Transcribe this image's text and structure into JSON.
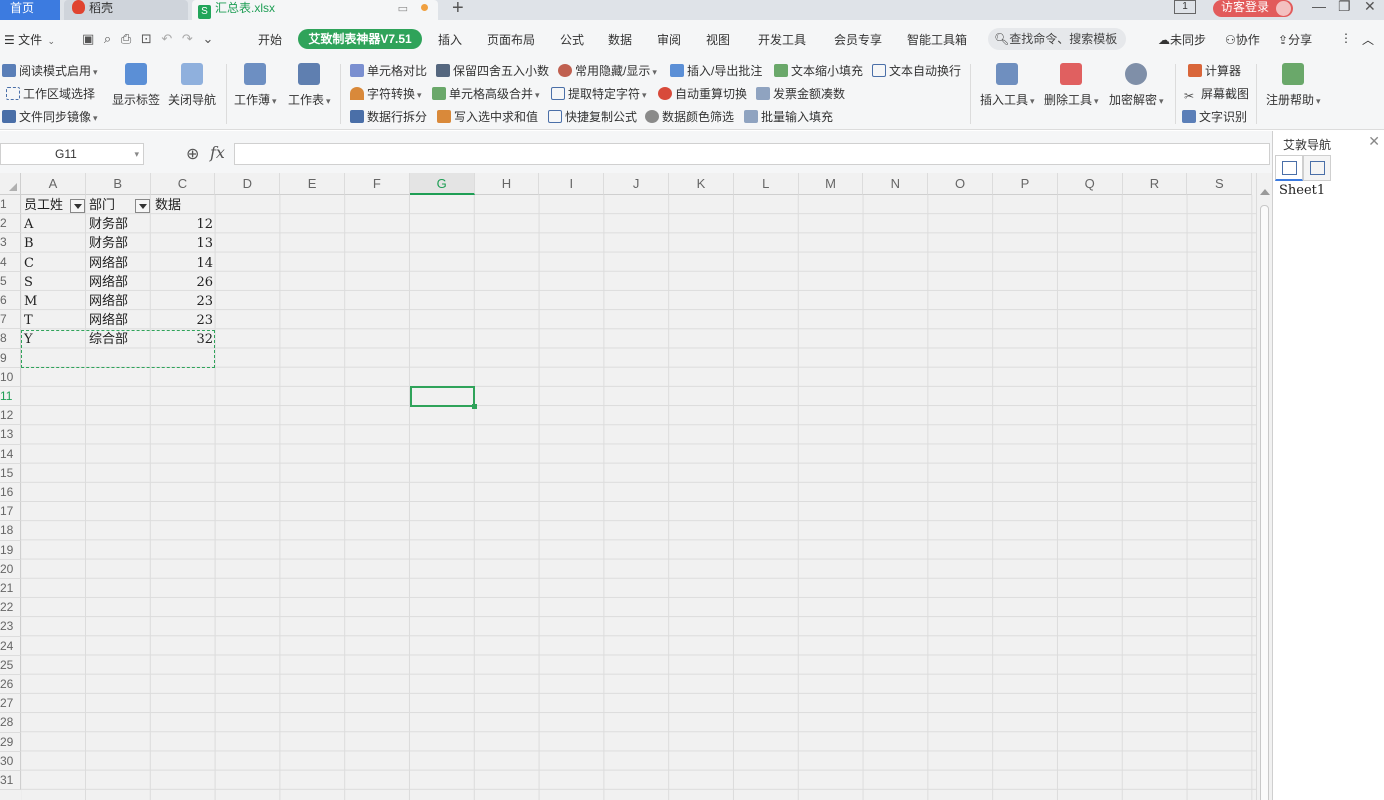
{
  "tabs": {
    "home": "首页",
    "daoke": "稻壳",
    "file": "汇总表.xlsx",
    "new_tab": "+"
  },
  "titlebar": {
    "badge": "1",
    "login": "访客登录",
    "minimize": "—",
    "restore": "❐",
    "close": "✕"
  },
  "menu": {
    "file": "文件",
    "items": [
      "开始",
      "艾致制表神器V7.51",
      "插入",
      "页面布局",
      "公式",
      "数据",
      "审阅",
      "视图",
      "开发工具",
      "会员专享",
      "智能工具箱"
    ],
    "search": "查找命令、搜索模板",
    "sync": "未同步",
    "collab": "协作",
    "share": "分享",
    "more": "⋮",
    "collapse": "︿"
  },
  "ribbon": {
    "read_mode": "阅读模式启用",
    "work_area": "工作区域选择",
    "file_sync": "文件同步镜像",
    "show_tags": "显示标签",
    "close_nav": "关闭导航",
    "workbook": "工作薄",
    "worksheet": "工作表",
    "row1": [
      "单元格对比",
      "保留四舍五入小数",
      "常用隐藏/显示",
      "插入/导出批注",
      "文本缩小填充",
      "文本自动换行"
    ],
    "row2": [
      "字符转换",
      "单元格高级合并",
      "提取特定字符",
      "自动重算切换",
      "发票金额凑数"
    ],
    "row3": [
      "数据行拆分",
      "写入选中求和值",
      "快捷复制公式",
      "数据颜色筛选",
      "批量输入填充"
    ],
    "insert_tools": "插入工具",
    "delete_tools": "删除工具",
    "encrypt": "加密解密",
    "calculator": "计算器",
    "screenshot": "屏幕截图",
    "ocr": "文字识别",
    "register_help": "注册帮助"
  },
  "formula_bar": {
    "name_box": "G11",
    "fx": "fx",
    "formula": ""
  },
  "grid": {
    "columns": [
      "A",
      "B",
      "C",
      "D",
      "E",
      "F",
      "G",
      "H",
      "I",
      "J",
      "K",
      "L",
      "M",
      "N",
      "O",
      "P",
      "Q",
      "R",
      "S"
    ],
    "selected_column": "G",
    "selected_row": "11",
    "row_count": 31,
    "header": [
      "员工姓",
      "部门",
      "数据"
    ],
    "rows": [
      [
        "A",
        "财务部",
        "12"
      ],
      [
        "B",
        "财务部",
        "13"
      ],
      [
        "C",
        "网络部",
        "14"
      ],
      [
        "S",
        "网络部",
        "26"
      ],
      [
        "M",
        "网络部",
        "23"
      ],
      [
        "T",
        "网络部",
        "23"
      ],
      [
        "Y",
        "综合部",
        "32"
      ]
    ]
  },
  "nav_panel": {
    "title": "艾敦导航",
    "close": "✕",
    "sheets": [
      "Sheet1"
    ]
  },
  "colors": {
    "accent_green": "#2fa35a",
    "home_tab_blue": "#3c7be0",
    "login_red": "#e25b5b"
  }
}
